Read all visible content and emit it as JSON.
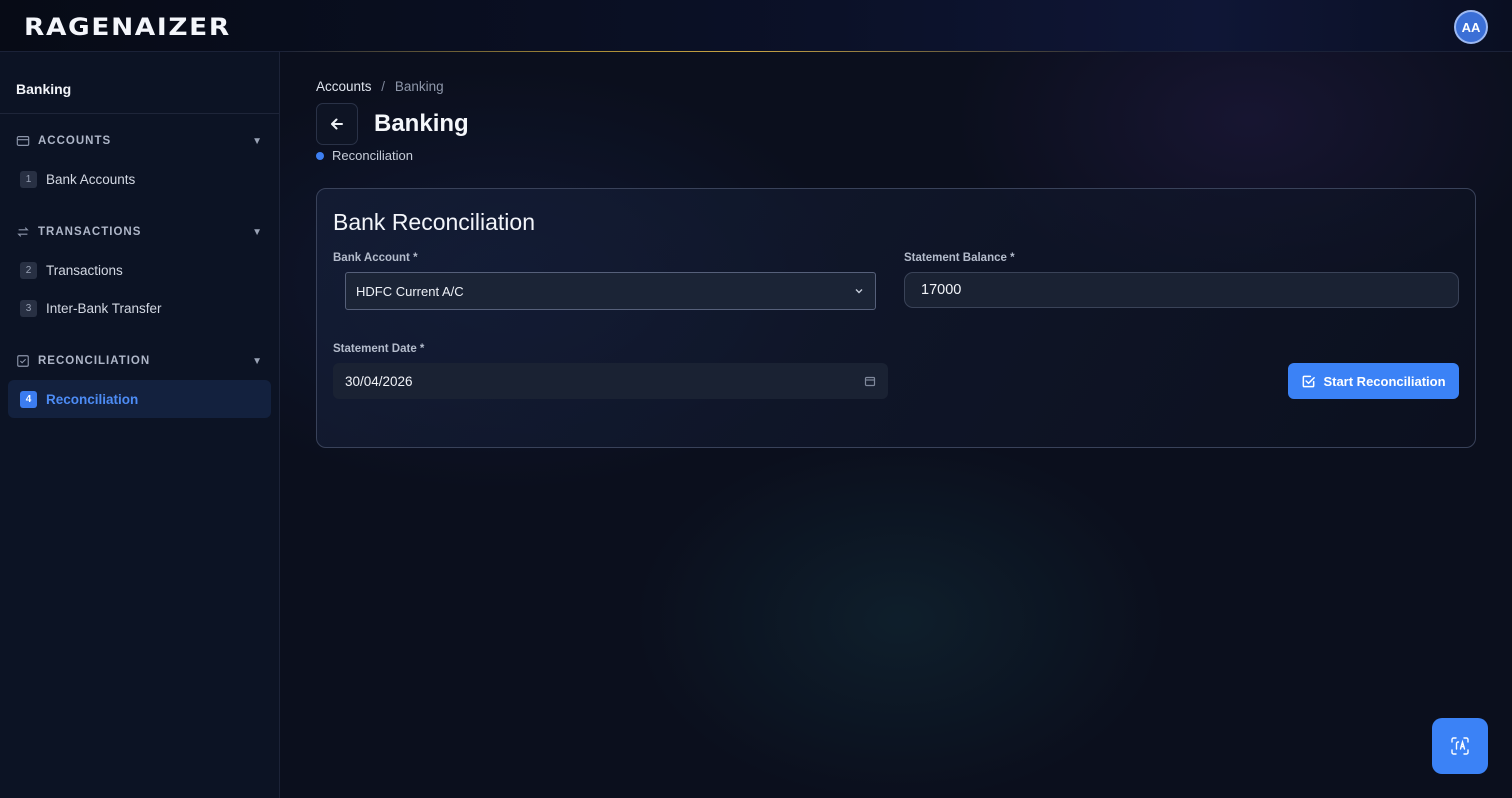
{
  "header": {
    "logo_text": "RAGENAIZER",
    "avatar_initials": "AA"
  },
  "sidebar": {
    "title": "Banking",
    "sections": [
      {
        "label": "ACCOUNTS",
        "icon": "card-icon",
        "items": [
          {
            "num": "1",
            "label": "Bank Accounts",
            "active": false
          }
        ]
      },
      {
        "label": "TRANSACTIONS",
        "icon": "swap-icon",
        "items": [
          {
            "num": "2",
            "label": "Transactions",
            "active": false
          },
          {
            "num": "3",
            "label": "Inter-Bank Transfer",
            "active": false
          }
        ]
      },
      {
        "label": "RECONCILIATION",
        "icon": "checkbox-icon",
        "items": [
          {
            "num": "4",
            "label": "Reconciliation",
            "active": true
          }
        ]
      }
    ]
  },
  "main": {
    "breadcrumb": {
      "parent": "Accounts",
      "separator": "/",
      "current": "Banking"
    },
    "page_title": "Banking",
    "subtab": "Reconciliation",
    "card": {
      "title": "Bank Reconciliation",
      "bank_account_label": "Bank Account *",
      "bank_account_value": "HDFC Current A/C",
      "statement_balance_label": "Statement Balance *",
      "statement_balance_value": "17000",
      "statement_date_label": "Statement Date *",
      "statement_date_value": "30/04/2026",
      "start_button_label": "Start Reconciliation"
    }
  },
  "colors": {
    "accent": "#3b82f6",
    "active_nav_text": "#4d8cf5",
    "background": "#0b0f1d"
  }
}
